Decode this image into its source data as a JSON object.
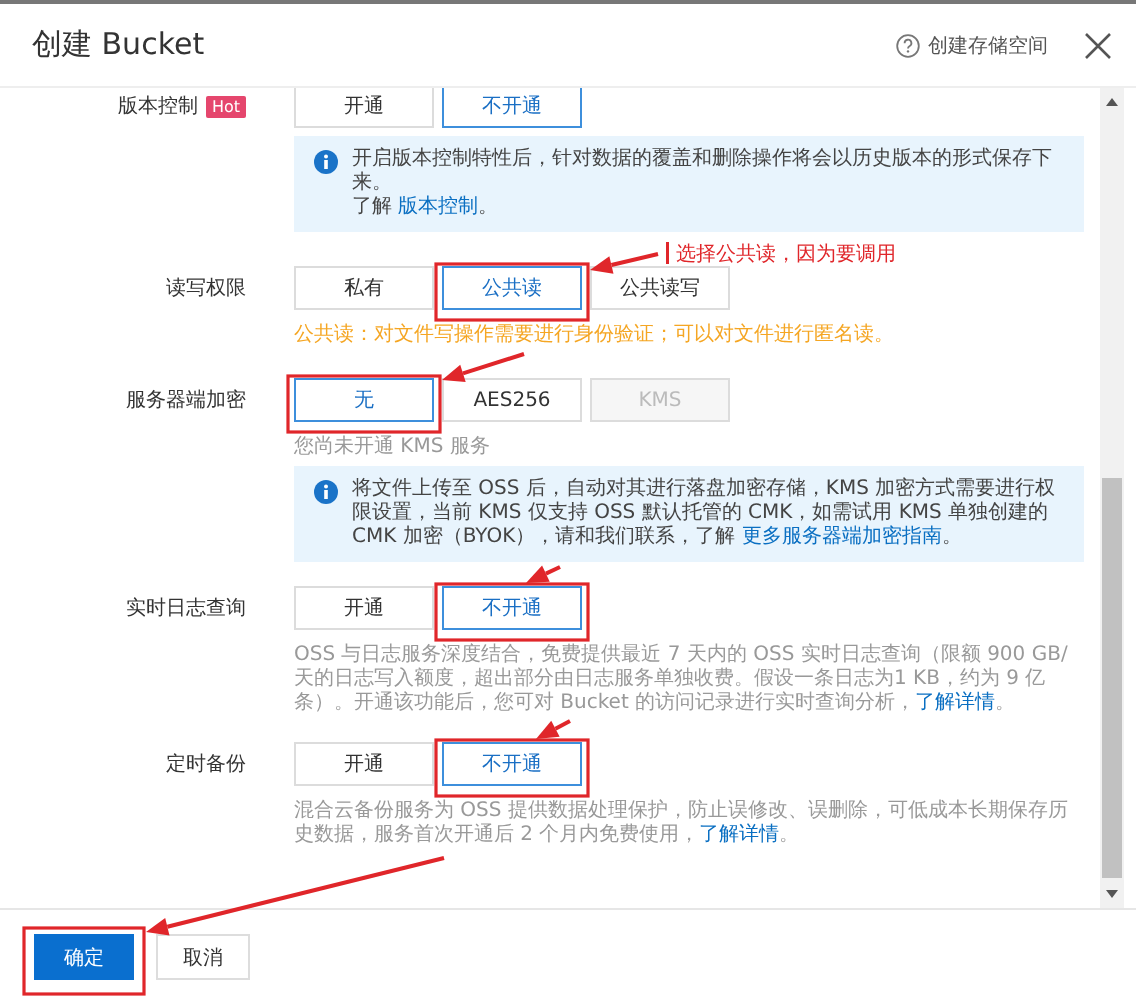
{
  "window": {
    "title": "创建 Bucket",
    "help_link": "创建存储空间"
  },
  "sections": [
    {
      "label": "版本控制",
      "badge": "Hot",
      "options": [
        {
          "label": "开通",
          "selected": false,
          "disabled": false
        },
        {
          "label": "不开通",
          "selected": true,
          "disabled": false
        }
      ],
      "notes": [
        {
          "kind": "info",
          "parts": [
            {
              "kind": "text",
              "text": "开启版本控制特性后，针对数据的覆盖和删除操作将会以历史版本的形式保存下来。"
            },
            {
              "kind": "break"
            },
            {
              "kind": "text",
              "text": "了解 "
            },
            {
              "kind": "link",
              "text": "版本控制"
            },
            {
              "kind": "text",
              "text": "。"
            }
          ]
        }
      ]
    },
    {
      "label": "读写权限",
      "options": [
        {
          "label": "私有",
          "selected": false,
          "disabled": false
        },
        {
          "label": "公共读",
          "selected": true,
          "disabled": false
        },
        {
          "label": "公共读写",
          "selected": false,
          "disabled": false
        }
      ],
      "notes": [
        {
          "kind": "warning",
          "parts": [
            {
              "kind": "text",
              "text": "公共读：对文件写操作需要进行身份验证；可以对文件进行匿名读。"
            }
          ]
        }
      ]
    },
    {
      "label": "服务器端加密",
      "options": [
        {
          "label": "无",
          "selected": true,
          "disabled": false
        },
        {
          "label": "AES256",
          "selected": false,
          "disabled": false
        },
        {
          "label": "KMS",
          "selected": false,
          "disabled": true
        }
      ],
      "notes": [
        {
          "kind": "hint",
          "parts": [
            {
              "kind": "text",
              "text": "您尚未开通 KMS 服务"
            }
          ]
        },
        {
          "kind": "info",
          "parts": [
            {
              "kind": "text",
              "text": "将文件上传至 OSS 后，自动对其进行落盘加密存储，KMS 加密方式需要进行权限设置，当前 KMS 仅支持 OSS 默认托管的 CMK，如需试用 KMS 单独创建的 CMK 加密（BYOK），请和我们联系，了解 "
            },
            {
              "kind": "link",
              "text": "更多服务器端加密指南"
            },
            {
              "kind": "text",
              "text": "。"
            }
          ]
        }
      ]
    },
    {
      "label": "实时日志查询",
      "options": [
        {
          "label": "开通",
          "selected": false,
          "disabled": false
        },
        {
          "label": "不开通",
          "selected": true,
          "disabled": false
        }
      ],
      "notes": [
        {
          "kind": "text",
          "parts": [
            {
              "kind": "text",
              "text": "OSS 与日志服务深度结合，免费提供最近 7 天内的 OSS 实时日志查询（限额 900 GB/天的日志写入额度，超出部分由日志服务单独收费。假设一条日志为1 KB，约为 9 亿条）。开通该功能后，您可对 Bucket 的访问记录进行实时查询分析，"
            },
            {
              "kind": "link",
              "text": "了解详情"
            },
            {
              "kind": "text",
              "text": "。"
            }
          ]
        }
      ]
    },
    {
      "label": "定时备份",
      "options": [
        {
          "label": "开通",
          "selected": false,
          "disabled": false
        },
        {
          "label": "不开通",
          "selected": true,
          "disabled": false
        }
      ],
      "notes": [
        {
          "kind": "text",
          "parts": [
            {
              "kind": "text",
              "text": "混合云备份服务为 OSS 提供数据处理保护，防止误修改、误删除，可低成本长期保存历史数据，服务首次开通后 2 个月内免费使用，"
            },
            {
              "kind": "link",
              "text": "了解详情"
            },
            {
              "kind": "text",
              "text": "。"
            }
          ]
        }
      ]
    }
  ],
  "footer": {
    "buttons": [
      {
        "label": "确定",
        "kind": "primary"
      },
      {
        "label": "取消",
        "kind": "default"
      }
    ]
  },
  "annotation": {
    "text": "选择公共读，因为要调用"
  }
}
